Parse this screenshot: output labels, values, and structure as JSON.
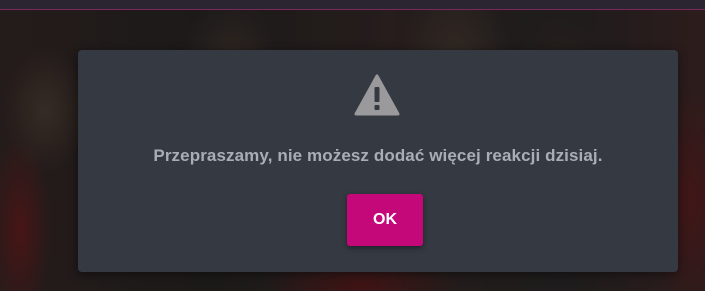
{
  "dialog": {
    "icon": "warning-triangle-icon",
    "message": "Przepraszamy, nie możesz dodać więcej reakcji dzisiaj.",
    "ok_label": "OK"
  },
  "colors": {
    "dialog_background": "#353a42",
    "message_text": "#a9adb4",
    "icon": "#9a9a9c",
    "button_background": "#c4087a",
    "button_text": "#ffffff"
  }
}
